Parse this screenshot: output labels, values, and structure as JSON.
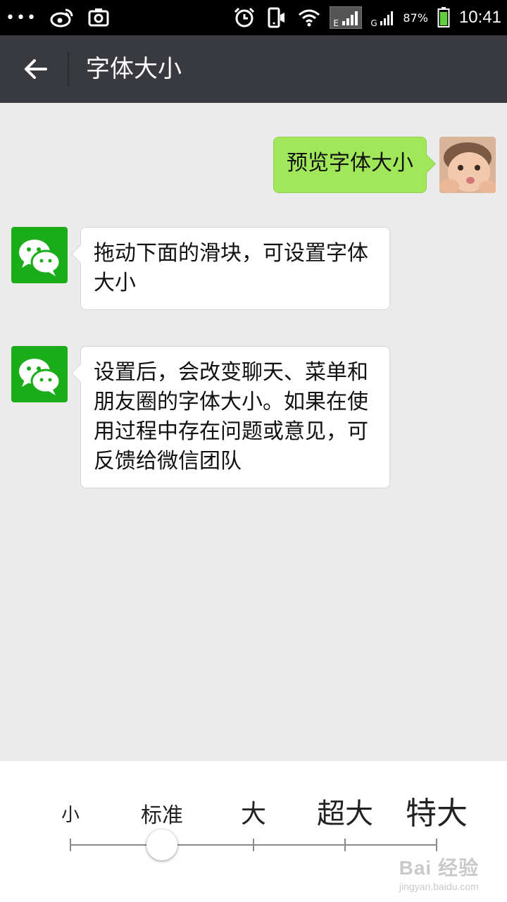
{
  "status_bar": {
    "battery_percent": "87%",
    "time": "10:41",
    "network_1": "E",
    "network_2": "G",
    "icons": [
      "more-dots-icon",
      "weibo-icon",
      "screenshot-icon",
      "alarm-icon",
      "vibrate-icon",
      "wifi-icon",
      "signal-icon",
      "signal-icon",
      "battery-icon"
    ]
  },
  "header": {
    "title": "字体大小",
    "back_icon": "arrow-left-icon"
  },
  "messages": [
    {
      "side": "right",
      "text": "预览字体大小",
      "avatar": "user-photo"
    },
    {
      "side": "left",
      "text": "拖动下面的滑块，可设置字体大小",
      "avatar": "wechat-logo"
    },
    {
      "side": "left",
      "text": "设置后，会改变聊天、菜单和朋友圈的字体大小。如果在使用过程中存在问题或意见，可反馈给微信团队",
      "avatar": "wechat-logo"
    }
  ],
  "font_slider": {
    "levels": [
      "小",
      "标准",
      "大",
      "超大",
      "特大"
    ],
    "selected_index": 1,
    "selected_label": "标准"
  },
  "watermark": {
    "logo_text": "Bai 经验",
    "url": "jingyan.baidu.com"
  },
  "colors": {
    "status_bar": "#000000",
    "title_bar": "#393a3f",
    "chat_background": "#ebebeb",
    "sent_bubble": "#a0e75a",
    "received_bubble": "#ffffff",
    "wechat_green": "#1aad19"
  }
}
